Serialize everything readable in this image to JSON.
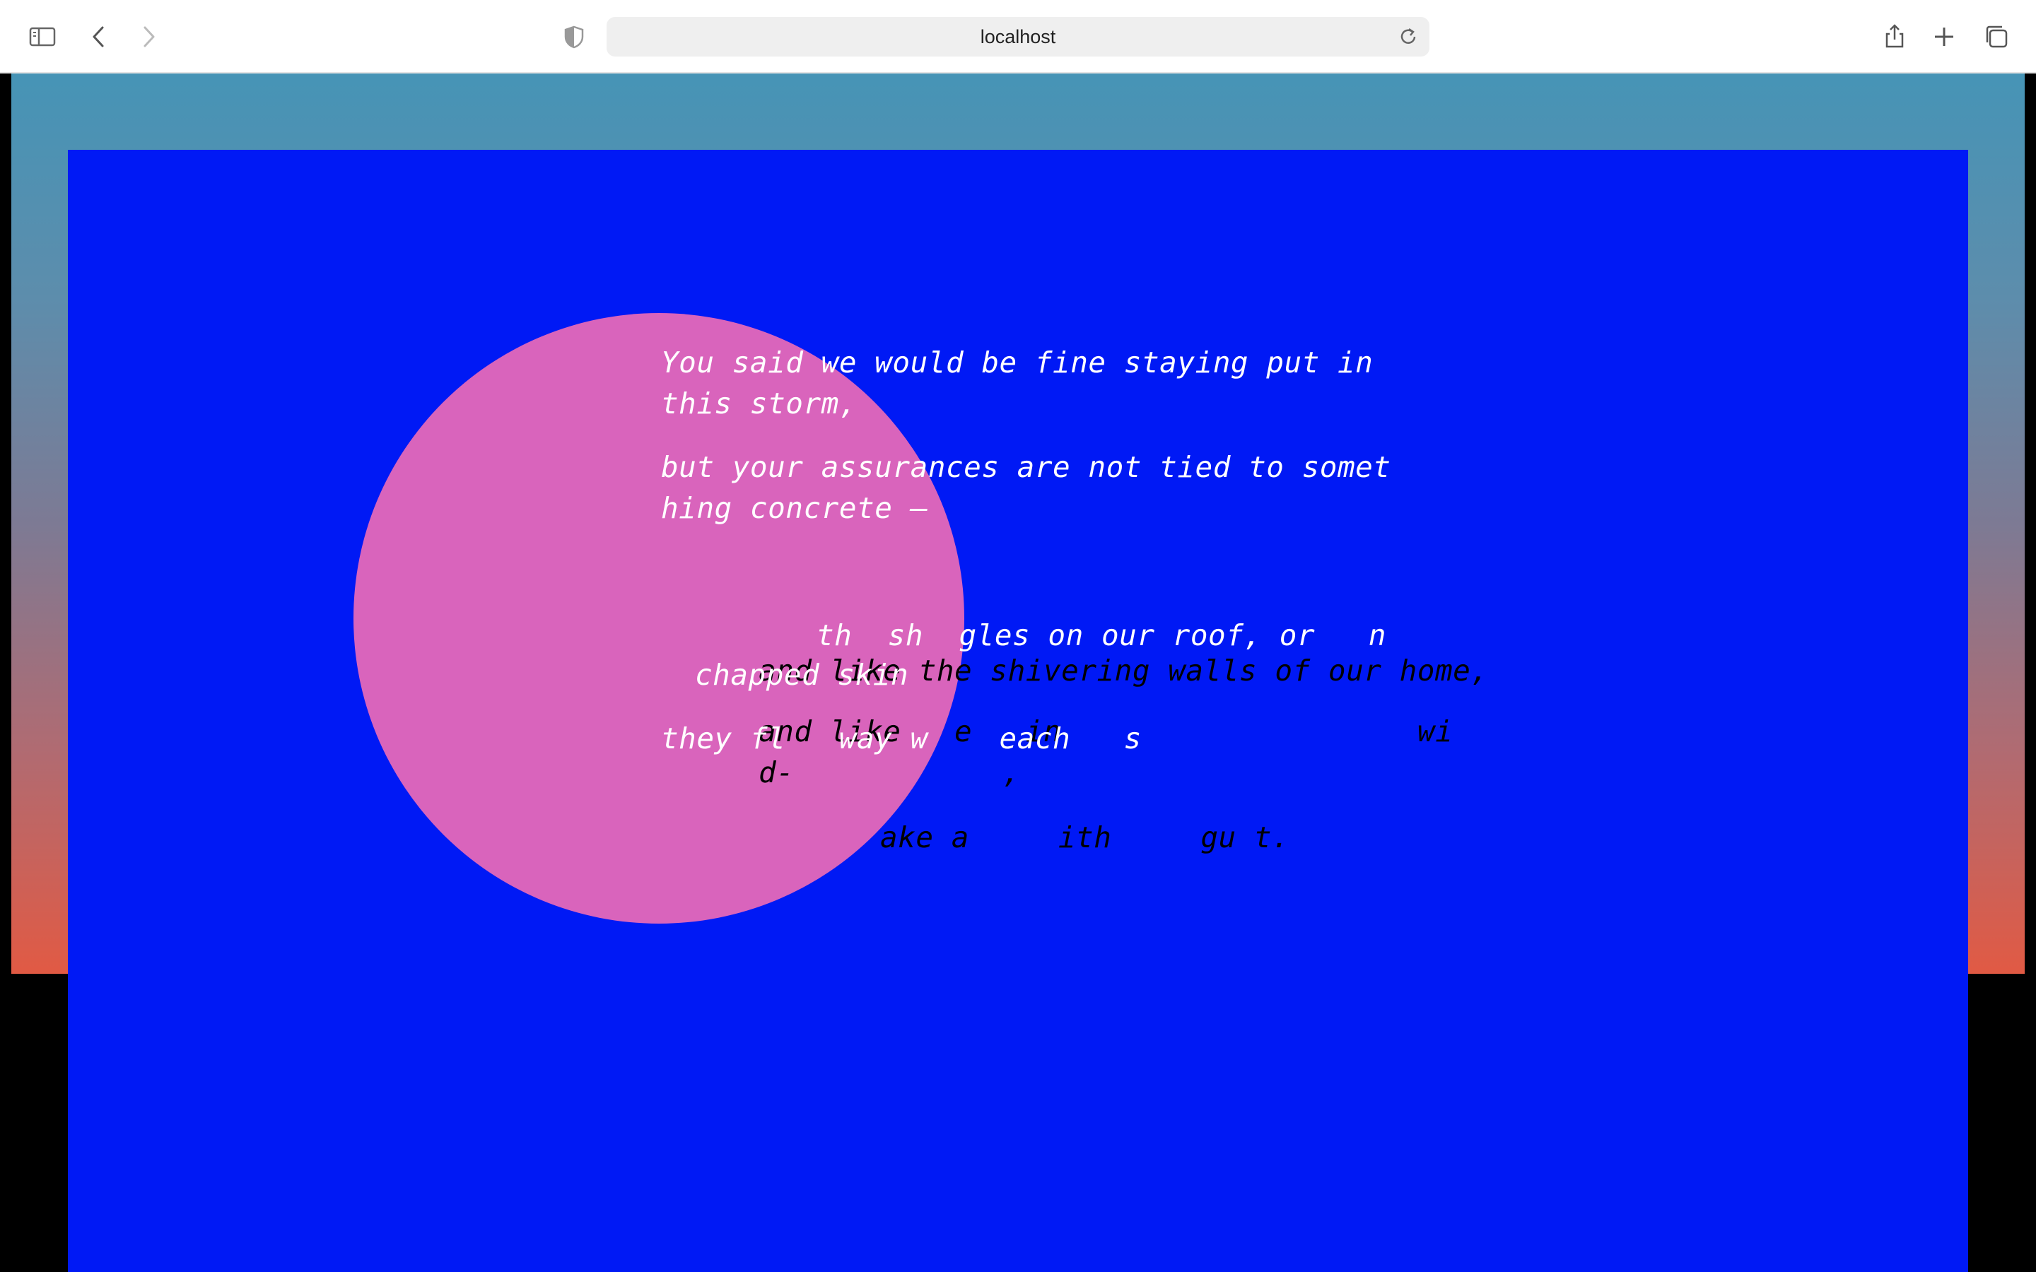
{
  "browser": {
    "url": "localhost"
  },
  "poem": {
    "line1a": "You said we would be fine staying put in",
    "line1b": "this storm,",
    "line2a": "but your assurances are not tied to somet",
    "line2b": "hing concrete —",
    "frag_white_1": "th  sh  gles on our roof, or   n",
    "frag_white_2": "chapped skin",
    "frag_black_1": "and like the shivering walls of our home,",
    "frag_white_3": "they fl   way w    each   s",
    "frag_black_2": "and like   e   in",
    "frag_black_3": "wi",
    "frag_black_4": "d-",
    "frag_black_5": ",",
    "frag_black_6": "ake a     ith     gu t."
  },
  "colors": {
    "panel": "#0019f5",
    "circle": "#d964bc",
    "gradient_top": "#4694b6",
    "gradient_bottom": "#e15a44"
  }
}
